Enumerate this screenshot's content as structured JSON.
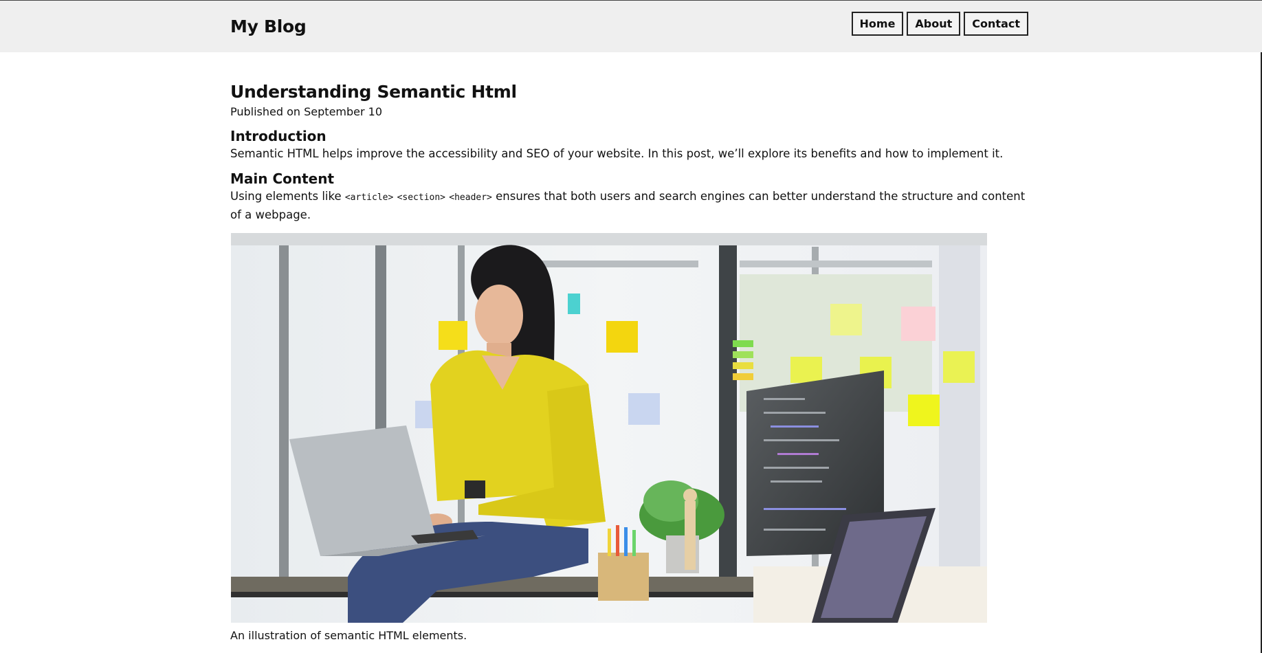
{
  "header": {
    "brand": "My Blog",
    "nav": [
      "Home",
      "About",
      "Contact"
    ]
  },
  "article": {
    "title": "Understanding Semantic Html",
    "meta": "Published on September 10",
    "intro_heading": "Introduction",
    "intro_text": "Semantic HTML helps improve the accessibility and SEO of your website. In this post, we’ll explore its benefits and how to implement it.",
    "main_heading": "Main Content",
    "main_prefix": "Using elements like ",
    "code_article": "<article>",
    "code_section": "<section>",
    "code_header": "<header>",
    "main_suffix": " ensures that both users and search engines can better understand the structure and content of a webpage."
  },
  "figure": {
    "caption": "An illustration of semantic HTML elements."
  }
}
